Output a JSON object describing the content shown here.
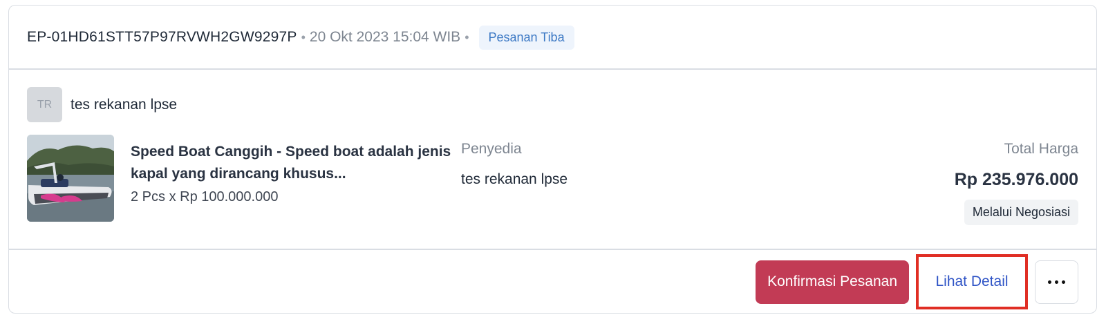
{
  "order": {
    "id": "EP-01HD61STT57P97RVWH2GW9297P",
    "separator": "•",
    "date": "20 Okt 2023 15:04 WIB",
    "status": "Pesanan Tiba"
  },
  "seller": {
    "avatar_initials": "TR",
    "name": "tes rekanan lpse"
  },
  "product": {
    "image_icon": "speed-boat-photo",
    "name": "Speed Boat Canggih - Speed boat adalah jenis kapal yang dirancang khusus...",
    "quantity_line": "2 Pcs x Rp 100.000.000"
  },
  "provider": {
    "label": "Penyedia",
    "name": "tes rekanan lpse"
  },
  "price": {
    "label": "Total Harga",
    "value": "Rp 235.976.000",
    "method": "Melalui Negosiasi"
  },
  "actions": {
    "confirm_label": "Konfirmasi Pesanan",
    "detail_label": "Lihat Detail",
    "more_icon": "more-horizontal-icon"
  },
  "colors": {
    "accent_confirm": "#c23b55",
    "link_blue": "#2f54c6",
    "status_blue": "#3b78c4",
    "highlight_red": "#e02e24"
  }
}
